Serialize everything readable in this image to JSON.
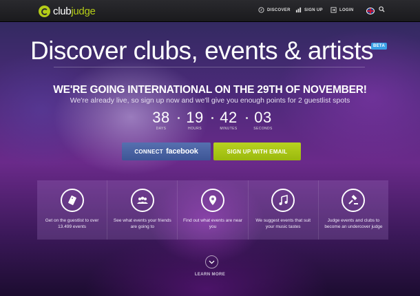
{
  "brand": {
    "club": "club",
    "judge": "judge"
  },
  "nav": {
    "discover": "DISCOVER",
    "signup": "SIGN UP",
    "login": "LOGIN"
  },
  "hero": {
    "title": "Discover clubs, events & artists",
    "badge": "BETA",
    "headline": "WE'RE GOING INTERNATIONAL ON THE 29TH OF NOVEMBER!",
    "subline": "We're already live, so sign up now and we'll give you enough points for 2 guestlist spots"
  },
  "countdown": {
    "days": "38",
    "days_label": "DAYS",
    "hours": "19",
    "hours_label": "HOURS",
    "minutes": "42",
    "minutes_label": "MINUTES",
    "seconds": "03",
    "seconds_label": "SECONDS"
  },
  "buttons": {
    "connect": "CONNECT",
    "facebook": "facebook",
    "email": "SIGN UP WITH EMAIL"
  },
  "features": [
    {
      "icon": "ticket-icon",
      "text": "Get on the guestlist to over 13.499 events"
    },
    {
      "icon": "friends-icon",
      "text": "See what events your friends are going to"
    },
    {
      "icon": "map-pin-icon",
      "text": "Find out what events are near you"
    },
    {
      "icon": "music-icon",
      "text": "We suggest events that suit your music tastes"
    },
    {
      "icon": "gavel-icon",
      "text": "Judge events and clubs to become an undercover judge"
    }
  ],
  "learn_more": "LEARN MORE",
  "colors": {
    "accent_green": "#b5cc18",
    "facebook_blue": "#3d5696",
    "beta_blue": "#3aa0e6"
  }
}
